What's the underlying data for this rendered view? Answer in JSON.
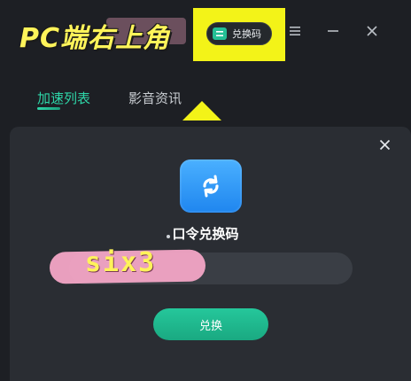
{
  "annotation": {
    "caption": "PC端右上角",
    "watermark": "six3"
  },
  "header": {
    "redeem_button_label": "兑换码",
    "menu_icon": "menu-icon",
    "minimize_icon": "minimize-icon",
    "close_icon": "close-icon"
  },
  "tabs": [
    {
      "label": "加速列表",
      "active": true
    },
    {
      "label": "影音资讯",
      "active": false
    }
  ],
  "dialog": {
    "title": "口令兑换码",
    "input_placeholder": "",
    "submit_label": "兑换",
    "close_icon": "close-icon",
    "logo_icon": "redeem-sync-icon"
  },
  "colors": {
    "accent": "#24c095",
    "highlight": "#f3f318",
    "caption_text": "#fff45a",
    "background": "#1d1f24",
    "dialog_bg": "#2a2d33"
  }
}
